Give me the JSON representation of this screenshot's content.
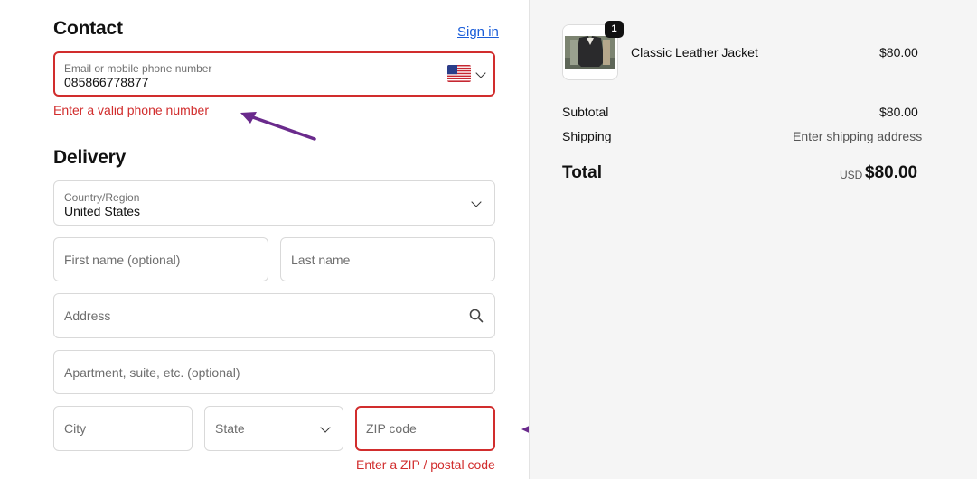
{
  "contact": {
    "heading": "Contact",
    "sign_in": "Sign in",
    "email_label": "Email or mobile phone number",
    "email_value": "085866778877",
    "error": "Enter a valid phone number"
  },
  "delivery": {
    "heading": "Delivery",
    "country_label": "Country/Region",
    "country_value": "United States",
    "first_name_placeholder": "First name (optional)",
    "last_name_placeholder": "Last name",
    "address_placeholder": "Address",
    "apartment_placeholder": "Apartment, suite, etc. (optional)",
    "city_placeholder": "City",
    "state_placeholder": "State",
    "zip_placeholder": "ZIP code",
    "zip_error": "Enter a ZIP / postal code"
  },
  "summary": {
    "item_qty": "1",
    "item_name": "Classic Leather Jacket",
    "item_price": "$80.00",
    "subtotal_label": "Subtotal",
    "subtotal_value": "$80.00",
    "shipping_label": "Shipping",
    "shipping_value": "Enter shipping address",
    "total_label": "Total",
    "total_currency": "USD",
    "total_value": "$80.00"
  },
  "colors": {
    "error": "#d12d2d",
    "link": "#1a5dd9",
    "annotation_arrow": "#6a2a8c"
  }
}
